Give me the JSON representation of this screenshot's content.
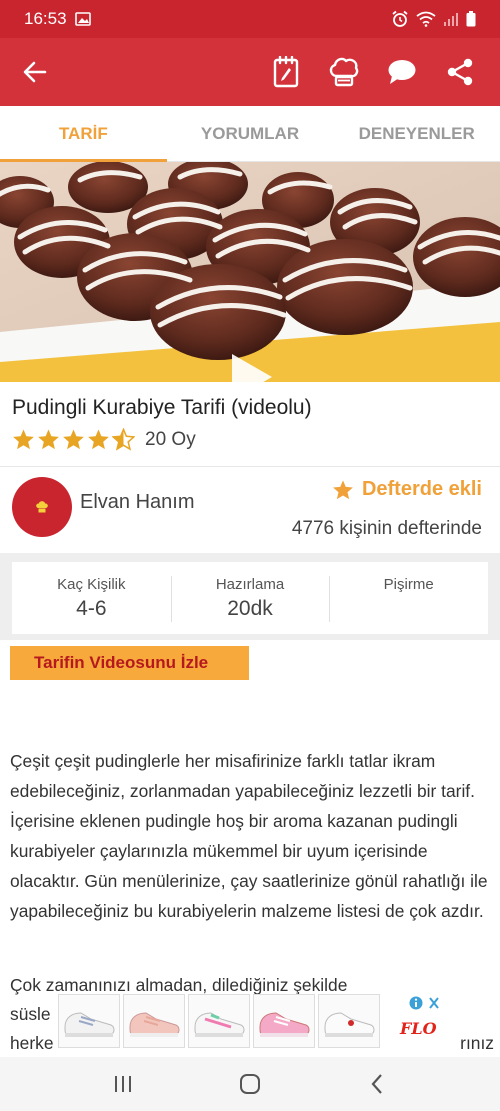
{
  "status_bar": {
    "time": "16:53"
  },
  "tabs": [
    {
      "label": "TARİF",
      "active": true
    },
    {
      "label": "YORUMLAR",
      "active": false
    },
    {
      "label": "DENEYENLER",
      "active": false
    }
  ],
  "recipe": {
    "title": "Pudingli Kurabiye Tarifi (videolu)",
    "rating": 4.5,
    "rating_count": "20 Oy"
  },
  "author": {
    "name": "Elvan Hanım"
  },
  "favorite": {
    "label": "Defterde ekli",
    "count_text": "4776 kişinin defterinde"
  },
  "info": [
    {
      "label": "Kaç Kişilik",
      "value": "4-6"
    },
    {
      "label": "Hazırlama",
      "value": "20dk"
    },
    {
      "label": "Pişirme",
      "value": ""
    }
  ],
  "video_button": {
    "label": "Tarifin Videosunu İzle"
  },
  "description": {
    "paragraph1": "Çeşit çeşit pudinglerle her misafirinize farklı tatlar ikram edebileceğiniz, zorlanmadan yapabileceğiniz lezzetli bir tarif. İçerisine eklenen pudingle hoş bir aroma kazanan pudingli kurabiyeler çaylarınızla mükemmel bir uyum içerisinde olacaktır. Gün menülerinize, çay saatlerinize gönül rahatlığı ile yapabileceğiniz bu kurabiyelerin malzeme listesi de çok azdır.",
    "paragraph2_line1": "Çok zamanınızı almadan, dilediğiniz şekilde",
    "paragraph2_line2_start": "süsle",
    "paragraph2_line3_start": "herke",
    "paragraph2_line3_end": "rınız"
  },
  "ad": {
    "brand": "FLO"
  },
  "colors": {
    "primary": "#d3323a",
    "status": "#c9252f",
    "accent": "#f0a13a",
    "video_button": "#f7a93c"
  },
  "icons": {
    "back": "arrow-left-icon",
    "notebook": "notebook-icon",
    "chef": "chef-hat-icon",
    "comment": "chat-bubble-icon",
    "share": "share-icon"
  }
}
